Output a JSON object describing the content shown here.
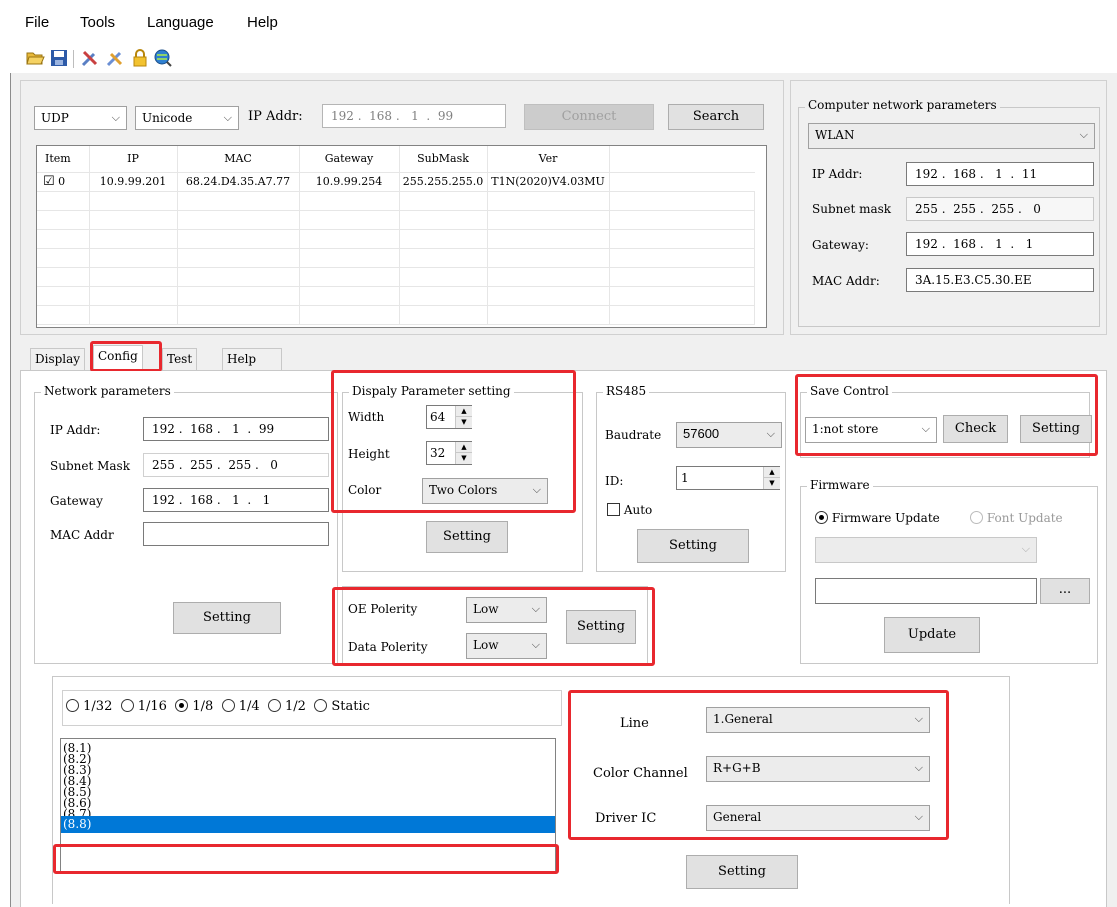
{
  "menu": [
    "File",
    "Tools",
    "Language",
    "Help"
  ],
  "toolbar_icons": [
    "open-folder-icon",
    "save-icon",
    "tools-icon",
    "clear-icon",
    "lock-icon",
    "globe-search-icon"
  ],
  "connection": {
    "protocol": "UDP",
    "encoding": "Unicode",
    "ip_label": "IP Addr:",
    "ip_value": "192 .  168 .   1  .  99",
    "connect_label": "Connect",
    "search_label": "Search"
  },
  "device_table": {
    "headers": [
      "Item",
      "IP",
      "MAC",
      "Gateway",
      "SubMask",
      "Ver"
    ],
    "rows": [
      {
        "checked": "☑",
        "item": "0",
        "ip": "10.9.99.201",
        "mac": "68.24.D4.35.A7.77",
        "gateway": "10.9.99.254",
        "submask": "255.255.255.0",
        "ver": "T1N(2020)V4.03MU"
      }
    ]
  },
  "computer_network": {
    "title": "Computer network parameters",
    "adapter": "WLAN",
    "ip_label": "IP Addr:",
    "ip_value": "192 .  168 .   1  .  11",
    "subnet_label": "Subnet mask",
    "subnet_value": "255 .  255 .  255 .   0",
    "gateway_label": "Gateway:",
    "gateway_value": "192 .  168 .   1  .   1",
    "mac_label": "MAC Addr:",
    "mac_value": "3A.15.E3.C5.30.EE"
  },
  "tabs": [
    "Display",
    "Config",
    "Test",
    "Help"
  ],
  "network_params": {
    "title": "Network parameters",
    "ip_label": "IP Addr:",
    "ip_value": "192 .  168 .   1  .  99",
    "subnet_label": "Subnet Mask",
    "subnet_value": "255 .  255 .  255 .   0",
    "gateway_label": "Gateway",
    "gateway_value": "192 .  168 .   1  .   1",
    "mac_label": "MAC Addr",
    "mac_value": "",
    "setting_label": "Setting"
  },
  "display_params": {
    "title": "Dispaly Parameter setting",
    "width_label": "Width",
    "width_value": "64",
    "height_label": "Height",
    "height_value": "32",
    "color_label": "Color",
    "color_value": "Two Colors",
    "setting_label": "Setting"
  },
  "rs485": {
    "title": "RS485",
    "baudrate_label": "Baudrate",
    "baudrate_value": "57600",
    "id_label": "ID:",
    "id_value": "1",
    "auto_label": "Auto",
    "setting_label": "Setting"
  },
  "save_control": {
    "title": "Save Control",
    "value": "1:not store",
    "check_label": "Check",
    "setting_label": "Setting"
  },
  "firmware": {
    "title": "Firmware",
    "firmware_update_label": "Firmware Update",
    "font_update_label": "Font Update",
    "browse_label": "...",
    "update_label": "Update"
  },
  "polarity": {
    "oe_label": "OE Polerity",
    "oe_value": "Low",
    "data_label": "Data Polerity",
    "data_value": "Low",
    "setting_label": "Setting"
  },
  "scan": {
    "options": [
      "1/32",
      "1/16",
      "1/8",
      "1/4",
      "1/2",
      "Static"
    ],
    "selected": "1/8",
    "list": [
      "(8.1)",
      "(8.2)",
      "(8.3)",
      "(8.4)",
      "(8.5)",
      "(8.6)",
      "(8.7)",
      "(8.8)"
    ],
    "selected_item": "(8.8)"
  },
  "line_config": {
    "line_label": "Line",
    "line_value": "1.General",
    "color_channel_label": "Color Channel",
    "color_channel_value": "R+G+B",
    "driver_ic_label": "Driver IC",
    "driver_ic_value": "General",
    "setting_label": "Setting"
  },
  "colors": {
    "highlight": "#e8282e",
    "selection": "#0078d7"
  }
}
